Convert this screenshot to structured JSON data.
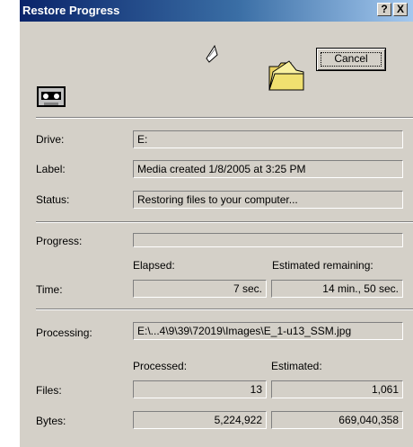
{
  "window": {
    "title": "Restore Progress",
    "help_button": "?",
    "close_button": "X"
  },
  "cancel_label": "Cancel",
  "icons": [
    "tape-icon",
    "flying-paper-icon",
    "open-folder-icon"
  ],
  "labels": {
    "drive": "Drive:",
    "label": "Label:",
    "status": "Status:",
    "progress": "Progress:",
    "time": "Time:",
    "processing": "Processing:",
    "files": "Files:",
    "bytes": "Bytes:"
  },
  "values": {
    "drive": "E:",
    "label": "Media created 1/8/2005 at 3:25 PM",
    "status": "Restoring files to your computer...",
    "progress_fraction": 0,
    "processing": "E:\\...4\\9\\39\\72019\\Images\\E_1-u13_SSM.jpg"
  },
  "time": {
    "elapsed_header": "Elapsed:",
    "remaining_header": "Estimated remaining:",
    "elapsed": "7 sec.",
    "remaining": "14 min., 50 sec."
  },
  "counts": {
    "processed_header": "Processed:",
    "estimated_header": "Estimated:",
    "files_processed": "13",
    "files_estimated": "1,061",
    "bytes_processed": "5,224,922",
    "bytes_estimated": "669,040,358"
  },
  "colors": {
    "title_gradient_start": "#0a246a",
    "dialog_face": "#d4d0c8",
    "folder_yellow": "#f0e070"
  }
}
